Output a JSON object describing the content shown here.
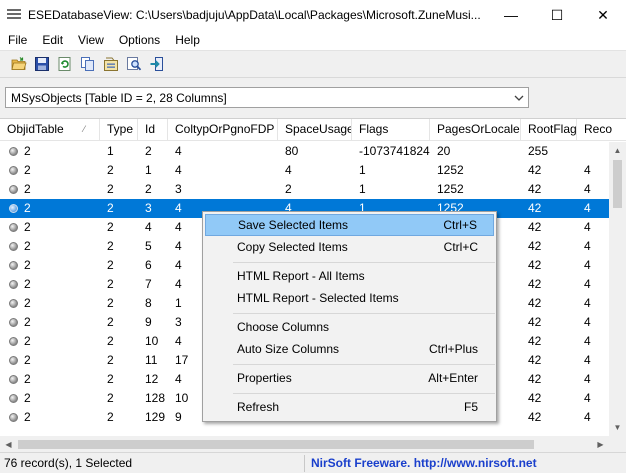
{
  "window": {
    "title": "ESEDatabaseView:  C:\\Users\\badjuju\\AppData\\Local\\Packages\\Microsoft.ZuneMusi...",
    "minimize_glyph": "—",
    "maximize_glyph": "☐",
    "close_glyph": "✕"
  },
  "menu": [
    "File",
    "Edit",
    "View",
    "Options",
    "Help"
  ],
  "toolbar": {
    "icons": [
      "open-folder-icon",
      "save-icon",
      "refresh-icon",
      "copy-icon",
      "properties-icon",
      "find-icon",
      "exit-icon"
    ]
  },
  "table_selector": {
    "value": "MSysObjects  [Table ID = 2, 28 Columns]"
  },
  "grid": {
    "columns": [
      "ObjidTable",
      "Type",
      "Id",
      "ColtypOrPgnoFDP",
      "SpaceUsage",
      "Flags",
      "PagesOrLocale",
      "RootFlag",
      "Reco"
    ],
    "sort_indicator": "⁄",
    "rows": [
      [
        "2",
        "1",
        "2",
        "4",
        "80",
        "-1073741824",
        "20",
        "255",
        ""
      ],
      [
        "2",
        "2",
        "1",
        "4",
        "4",
        "1",
        "1252",
        "42",
        "4"
      ],
      [
        "2",
        "2",
        "2",
        "3",
        "2",
        "1",
        "1252",
        "42",
        "4"
      ],
      [
        "2",
        "2",
        "3",
        "4",
        "4",
        "1",
        "1252",
        "42",
        "4"
      ],
      [
        "2",
        "2",
        "4",
        "4",
        "",
        "",
        "",
        "42",
        "4"
      ],
      [
        "2",
        "2",
        "5",
        "4",
        "",
        "",
        "",
        "42",
        "4"
      ],
      [
        "2",
        "2",
        "6",
        "4",
        "",
        "",
        "",
        "42",
        "4"
      ],
      [
        "2",
        "2",
        "7",
        "4",
        "",
        "",
        "",
        "42",
        "4"
      ],
      [
        "2",
        "2",
        "8",
        "1",
        "",
        "",
        "",
        "42",
        "4"
      ],
      [
        "2",
        "2",
        "9",
        "3",
        "",
        "",
        "",
        "42",
        "4"
      ],
      [
        "2",
        "2",
        "10",
        "4",
        "",
        "",
        "",
        "42",
        "4"
      ],
      [
        "2",
        "2",
        "11",
        "17",
        "",
        "",
        "",
        "42",
        "4"
      ],
      [
        "2",
        "2",
        "12",
        "4",
        "",
        "",
        "",
        "42",
        "4"
      ],
      [
        "2",
        "2",
        "128",
        "10",
        "",
        "",
        "",
        "42",
        "4"
      ],
      [
        "2",
        "2",
        "129",
        "9",
        "",
        "",
        "",
        "42",
        "4"
      ]
    ],
    "selected_row": 3
  },
  "context_menu": {
    "items": [
      {
        "label": "Save Selected Items",
        "shortcut": "Ctrl+S"
      },
      {
        "label": "Copy Selected Items",
        "shortcut": "Ctrl+C"
      },
      {
        "label": "HTML Report - All Items",
        "shortcut": ""
      },
      {
        "label": "HTML Report - Selected Items",
        "shortcut": ""
      },
      {
        "label": "Choose Columns",
        "shortcut": ""
      },
      {
        "label": "Auto Size Columns",
        "shortcut": "Ctrl+Plus"
      },
      {
        "label": "Properties",
        "shortcut": "Alt+Enter"
      },
      {
        "label": "Refresh",
        "shortcut": "F5"
      }
    ]
  },
  "status": {
    "records": "76 record(s), 1 Selected",
    "credit": "NirSoft Freeware.  http://www.nirsoft.net"
  }
}
